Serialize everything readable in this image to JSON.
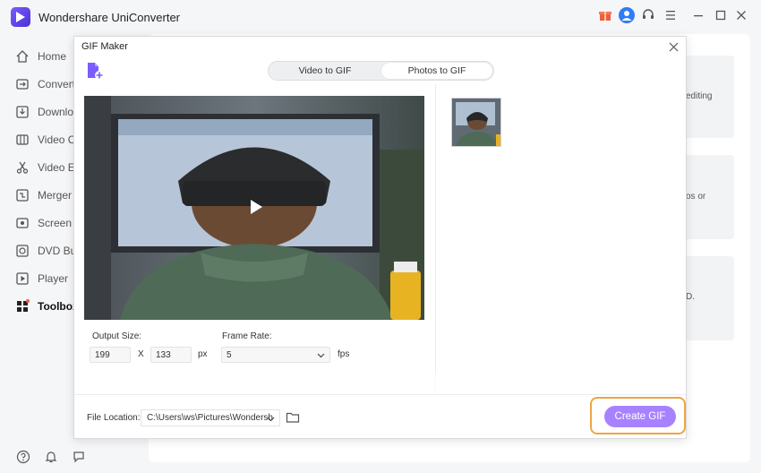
{
  "app": {
    "title": "Wondershare UniConverter",
    "logo_icon": "uniconverter-logo-icon",
    "window_controls": [
      "gift-icon",
      "user-avatar-icon",
      "headset-icon",
      "menu-icon",
      "minimize-icon",
      "maximize-icon",
      "close-icon"
    ]
  },
  "sidebar": {
    "items": [
      {
        "label": "Home",
        "icon": "home-icon"
      },
      {
        "label": "Converte",
        "icon": "convert-icon"
      },
      {
        "label": "Downlo",
        "icon": "download-icon"
      },
      {
        "label": "Video C",
        "icon": "video-compress-icon"
      },
      {
        "label": "Video Ec",
        "icon": "video-edit-icon"
      },
      {
        "label": "Merger",
        "icon": "merger-icon"
      },
      {
        "label": "Screen F",
        "icon": "screen-recorder-icon"
      },
      {
        "label": "DVD Bu",
        "icon": "dvd-burner-icon"
      },
      {
        "label": "Player",
        "icon": "player-icon"
      },
      {
        "label": "Toolbox",
        "icon": "toolbox-icon",
        "active": true
      }
    ],
    "bottom_icons": [
      "help-icon",
      "notification-bell-icon",
      "feedback-icon"
    ]
  },
  "background_cards": [
    {
      "text": "editing"
    },
    {
      "text": "os or"
    },
    {
      "text": "D."
    }
  ],
  "dialog": {
    "title": "GIF Maker",
    "tabs": [
      {
        "label": "Video to GIF",
        "active": false
      },
      {
        "label": "Photos to GIF",
        "active": true
      }
    ],
    "output_size_label": "Output Size:",
    "width_value": "199",
    "x_separator": "X",
    "height_value": "133",
    "size_unit": "px",
    "frame_rate_label": "Frame Rate:",
    "frame_rate_value": "5",
    "frame_rate_unit": "fps",
    "file_location_label": "File Location:",
    "file_location_value": "C:\\Users\\ws\\Pictures\\Wondersh",
    "create_button": "Create GIF"
  },
  "colors": {
    "accent": "#a782ff",
    "highlight_border": "#f0a444",
    "logo": "#5b3ae6",
    "avatar": "#2f7cf6",
    "gift": "#f05a4a"
  }
}
